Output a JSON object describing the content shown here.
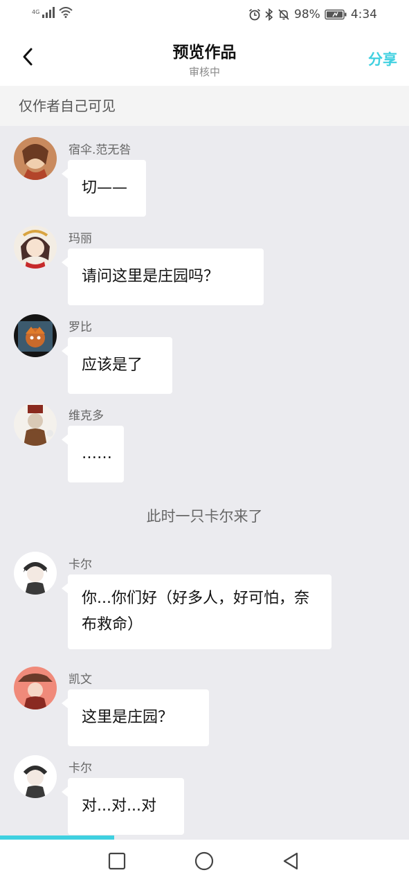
{
  "status_bar": {
    "network": "4G",
    "battery_percent": "98%",
    "time": "4:34"
  },
  "header": {
    "title": "预览作品",
    "subtitle": "审核中",
    "share_label": "分享"
  },
  "notice": "仅作者自己可见",
  "messages": [
    {
      "sender": "宿伞.范无咎",
      "text": "切——"
    },
    {
      "sender": "玛丽",
      "text": "请问这里是庄园吗？"
    },
    {
      "sender": "罗比",
      "text": "应该是了"
    },
    {
      "sender": "维克多",
      "text": "……"
    },
    {
      "sender": "卡尔",
      "text": "你...你们好（好多人，好可怕，奈布救命）"
    },
    {
      "sender": "凯文",
      "text": "这里是庄园？"
    },
    {
      "sender": "卡尔",
      "text": "对...对...对"
    }
  ],
  "narration": "此时一只卡尔来了",
  "progress": 0.28,
  "colors": {
    "accent": "#3fd0e0",
    "background": "#ebebef",
    "bubble": "#ffffff"
  }
}
